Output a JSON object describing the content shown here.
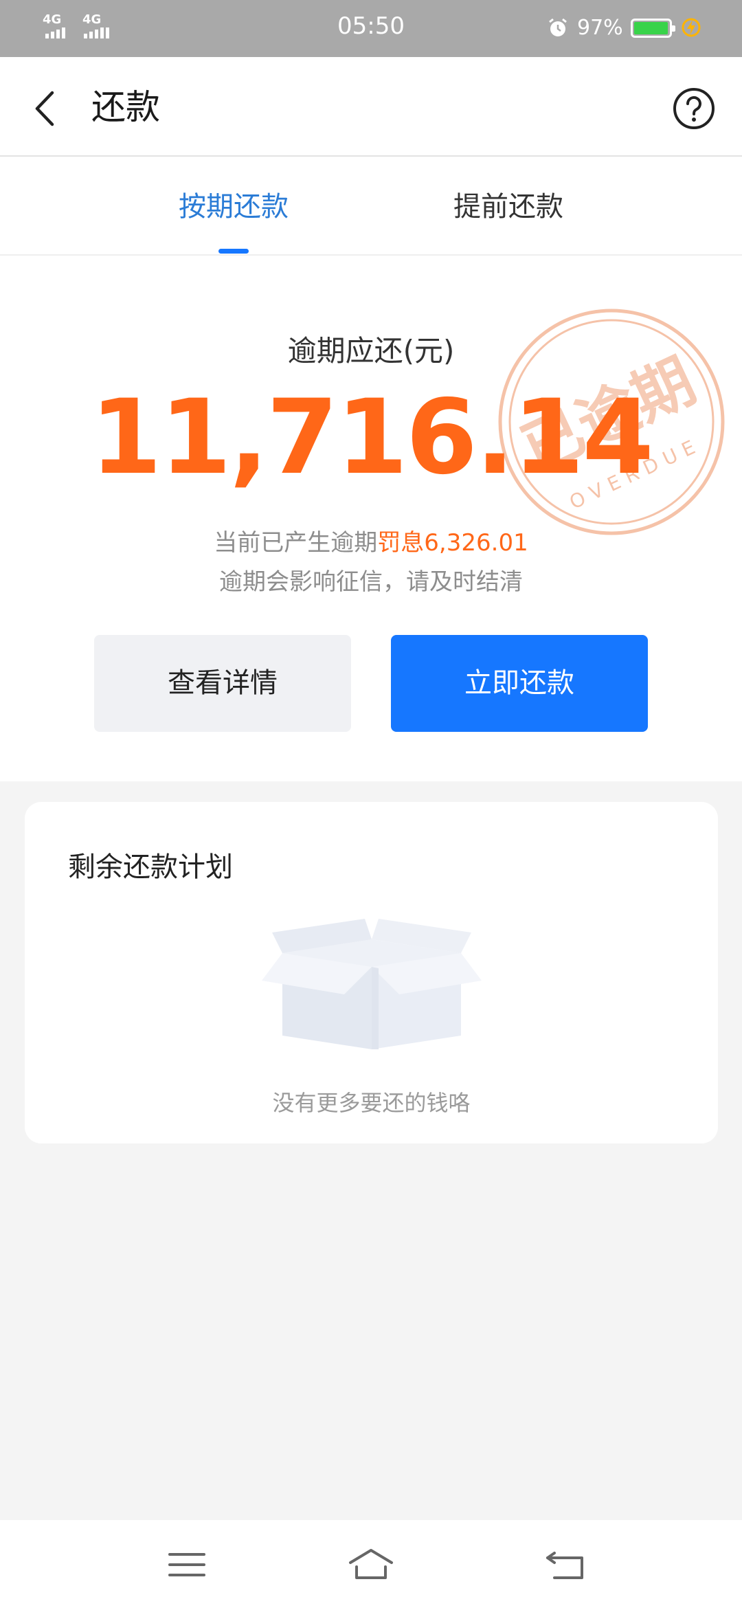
{
  "status_bar": {
    "signal_1": "4G",
    "signal_2": "4G",
    "time": "05:50",
    "battery_percent": "97%",
    "battery_level": 0.97,
    "icons": [
      "alarm-icon",
      "battery-icon",
      "charging-icon"
    ]
  },
  "header": {
    "title": "还款",
    "back_icon": "chevron-left-icon",
    "help_icon": "question-circle-icon"
  },
  "tabs": {
    "items": [
      {
        "label": "按期还款",
        "active": true
      },
      {
        "label": "提前还款",
        "active": false
      }
    ]
  },
  "overdue": {
    "label": "逾期应还(元)",
    "amount": "11,716.14",
    "penalty_prefix": "当前已产生逾期",
    "penalty_label": "罚息",
    "penalty_amount": "6,326.01",
    "warning": "逾期会影响征信，请及时结清",
    "stamp_text": "已逾期",
    "stamp_subtext": "OVERDUE"
  },
  "actions": {
    "details_label": "查看详情",
    "pay_now_label": "立即还款"
  },
  "plan": {
    "title": "剩余还款计划",
    "empty_icon": "empty-box-icon",
    "empty_text": "没有更多要还的钱咯"
  },
  "colors": {
    "accent_blue": "#1677ff",
    "tab_active": "#2b7cd6",
    "amount_orange": "#ff6718",
    "stamp": "#f5c2a8"
  },
  "nav_bar": {
    "icons": [
      "menu-icon",
      "home-icon",
      "back-icon"
    ]
  }
}
